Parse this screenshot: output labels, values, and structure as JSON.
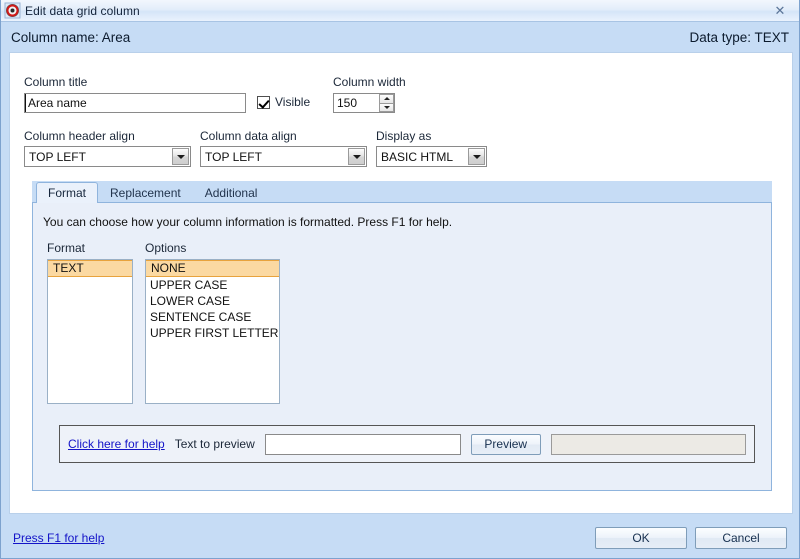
{
  "window": {
    "title": "Edit data grid column",
    "icon": "target-icon",
    "close_label": "✕"
  },
  "header": {
    "column_name_label": "Column name: Area",
    "data_type_label": "Data type: TEXT"
  },
  "form": {
    "column_title_label": "Column title",
    "column_title_value": "Area name",
    "visible_label": "Visible",
    "visible_checked": true,
    "column_width_label": "Column width",
    "column_width_value": "150",
    "column_header_align_label": "Column header align",
    "column_header_align_value": "TOP LEFT",
    "column_data_align_label": "Column data align",
    "column_data_align_value": "TOP LEFT",
    "display_as_label": "Display as",
    "display_as_value": "BASIC HTML"
  },
  "tabs": [
    {
      "label": "Format",
      "active": true
    },
    {
      "label": "Replacement",
      "active": false
    },
    {
      "label": "Additional",
      "active": false
    }
  ],
  "format_tab": {
    "description": "You can choose how your column information is formatted.  Press F1 for help.",
    "format_list_label": "Format",
    "format_items": [
      {
        "label": "TEXT",
        "selected": true
      }
    ],
    "options_list_label": "Options",
    "options_items": [
      {
        "label": "NONE",
        "selected": true
      },
      {
        "label": "UPPER CASE",
        "selected": false
      },
      {
        "label": "LOWER CASE",
        "selected": false
      },
      {
        "label": "SENTENCE CASE",
        "selected": false
      },
      {
        "label": "UPPER FIRST LETTERS",
        "selected": false
      }
    ],
    "help_link": "Click here for help",
    "text_to_preview_label": "Text to preview",
    "text_to_preview_value": "",
    "preview_button": "Preview",
    "preview_output_value": ""
  },
  "footer": {
    "help_link": "Press F1 for help",
    "ok_label": "OK",
    "cancel_label": "Cancel"
  },
  "colors": {
    "dialog_bg": "#c6dcf5",
    "panel_bg": "#ffffff",
    "tab_body_bg": "#e9eff9",
    "selection_fill": "#fbd9a2",
    "selection_border": "#e8a33d",
    "link": "#1414c8"
  }
}
